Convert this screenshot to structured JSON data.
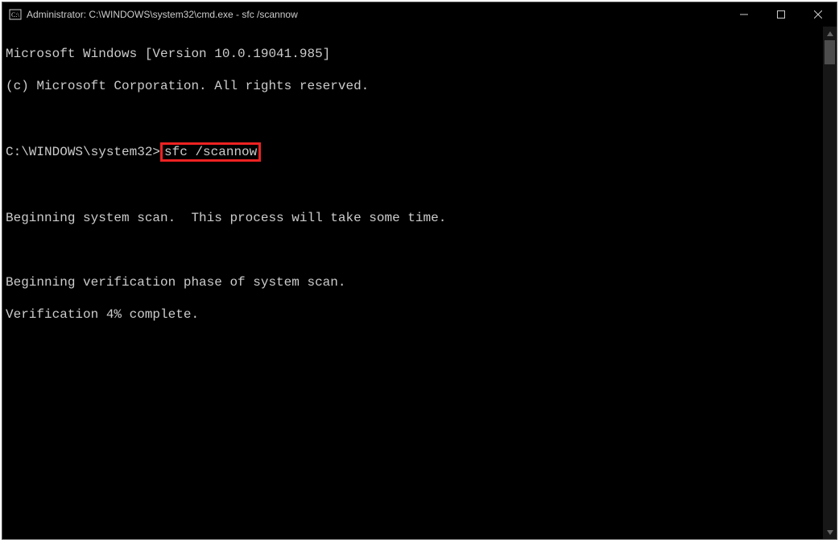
{
  "titlebar": {
    "title": "Administrator: C:\\WINDOWS\\system32\\cmd.exe - sfc  /scannow"
  },
  "terminal": {
    "line1": "Microsoft Windows [Version 10.0.19041.985]",
    "line2": "(c) Microsoft Corporation. All rights reserved.",
    "blank1": "",
    "prompt": "C:\\WINDOWS\\system32>",
    "command": "sfc /scannow",
    "blank2": "",
    "line_scan": "Beginning system scan.  This process will take some time.",
    "blank3": "",
    "line_verify_phase": "Beginning verification phase of system scan.",
    "line_verify_progress": "Verification 4% complete."
  }
}
